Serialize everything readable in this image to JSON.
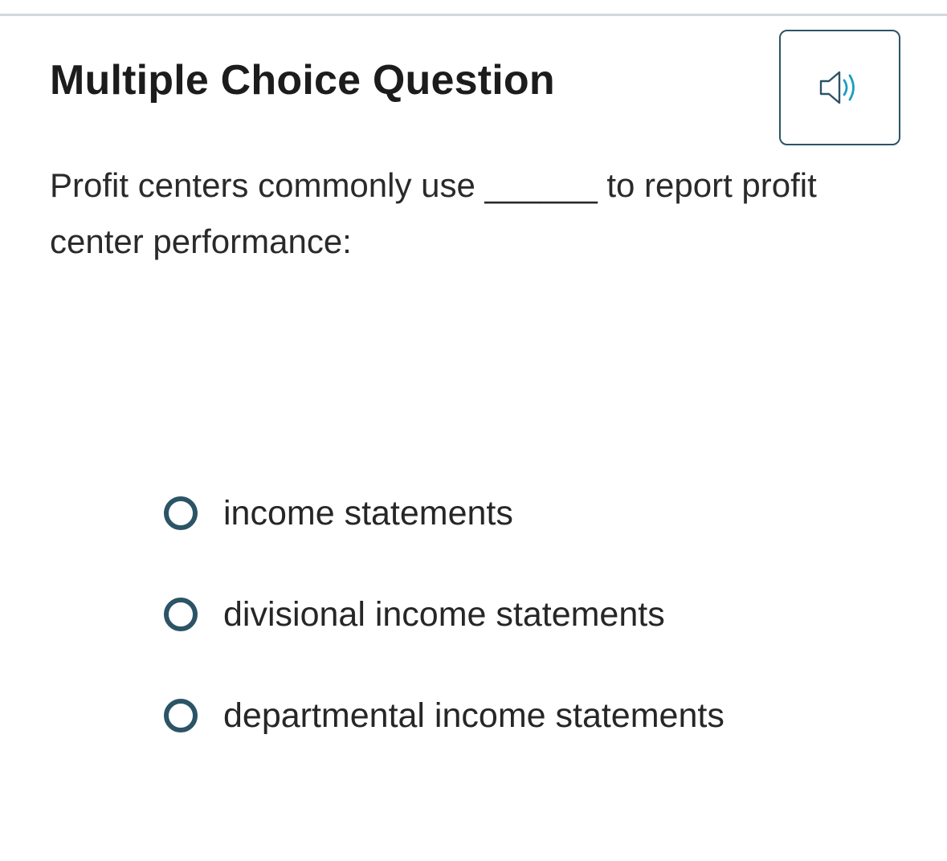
{
  "header": {
    "title": "Multiple Choice Question",
    "audio_icon": "speaker-icon",
    "audio_icon_colors": {
      "body": "#2b5466",
      "waves": "#1a9ec2"
    }
  },
  "question": {
    "text": "Profit centers commonly use ______ to report profit center performance:"
  },
  "options": [
    {
      "label": "income statements",
      "selected": false
    },
    {
      "label": "divisional income statements",
      "selected": false
    },
    {
      "label": "departmental income statements",
      "selected": false
    }
  ],
  "colors": {
    "accent": "#2b5466",
    "divider": "#d3d8dd"
  }
}
